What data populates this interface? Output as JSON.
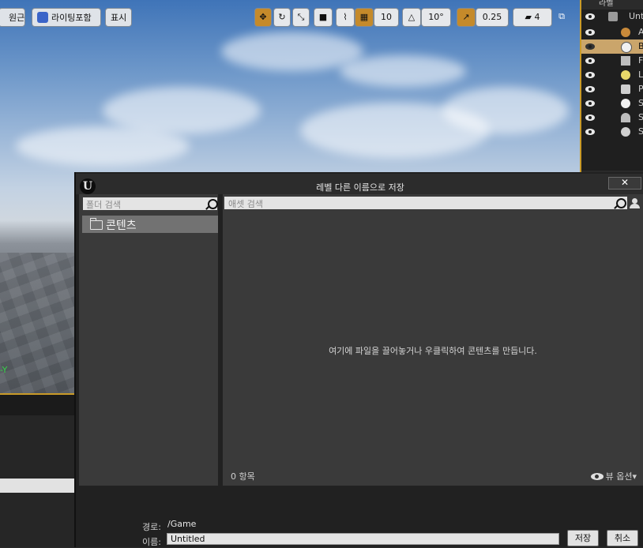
{
  "viewport": {
    "buttons": {
      "perspective": "원근",
      "lighting": "라이팅포함",
      "show": "표시"
    },
    "toolbar": {
      "grid_snap": "10",
      "rotation_snap": "10°",
      "scale_snap": "0.25",
      "camera_speed": "4"
    },
    "axis_label": "-Y",
    "accent_color": "#c99a28"
  },
  "outliner": {
    "header": "라벨",
    "rows": [
      {
        "label": "Untitled",
        "icon": "level-icon"
      },
      {
        "label": "A",
        "icon": "atmosphere-icon"
      },
      {
        "label": "B",
        "icon": "sphere-reflection-icon"
      },
      {
        "label": "F",
        "icon": "floor-icon"
      },
      {
        "label": "L",
        "icon": "light-icon"
      },
      {
        "label": "P",
        "icon": "player-start-icon"
      },
      {
        "label": "S",
        "icon": "sphere-icon"
      },
      {
        "label": "S",
        "icon": "skylight-icon"
      },
      {
        "label": "S",
        "icon": "sky-sphere-icon"
      }
    ]
  },
  "dialog": {
    "title": "레벨 다른 이름으로 저장",
    "close_symbol": "✕",
    "folder_search_placeholder": "폴더 검색",
    "folder_root": "콘텐츠",
    "asset_search_placeholder": "애셋 검색",
    "empty_message": "여기에 파일을 끌어놓거나 우클릭하여 콘텐츠를 만듭니다.",
    "item_count": "0 항목",
    "view_options": "뷰 옵션",
    "path_label": "경로:",
    "path_value": "/Game",
    "name_label": "이름:",
    "name_value": "Untitled",
    "save_button": "저장",
    "cancel_button": "취소"
  }
}
